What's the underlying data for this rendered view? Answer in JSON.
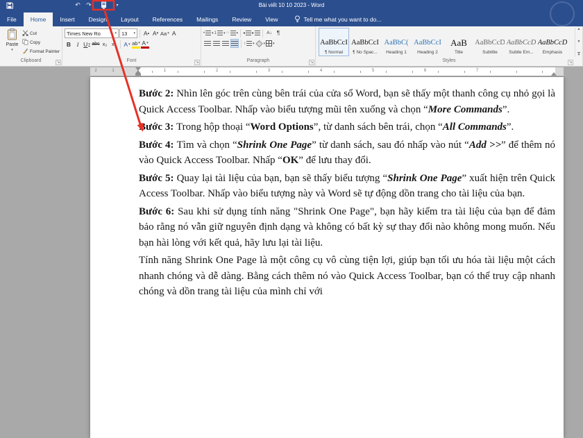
{
  "app": {
    "title": "Bài viết 10 10 2023 - Word"
  },
  "colors": {
    "titlebar": "#2b4e8e",
    "accent": "#2b579a",
    "ribbon_bg": "#f3f3f3",
    "document_bg": "#a9a9a9",
    "annotation_red": "#e53226",
    "highlight_yellow": "#ffe400",
    "font_color_red": "#c00000"
  },
  "icons": {
    "qat": [
      "save-icon",
      "undo-icon",
      "redo-icon",
      "shrink-one-page-icon",
      "customize-qat-chevron-icon"
    ],
    "undo_glyph": "↶",
    "redo_glyph": "↷",
    "dropdown_glyph": "▾",
    "launcher_glyph": "↘"
  },
  "ribbon": {
    "tabs": [
      {
        "label": "File",
        "active": false
      },
      {
        "label": "Home",
        "active": true
      },
      {
        "label": "Insert",
        "active": false
      },
      {
        "label": "Design",
        "active": false
      },
      {
        "label": "Layout",
        "active": false
      },
      {
        "label": "References",
        "active": false
      },
      {
        "label": "Mailings",
        "active": false
      },
      {
        "label": "Review",
        "active": false
      },
      {
        "label": "View",
        "active": false
      }
    ],
    "tell_me": "Tell me what you want to do...",
    "clipboard": {
      "label": "Clipboard",
      "paste": "Paste",
      "cut": "Cut",
      "copy": "Copy",
      "format_painter": "Format Painter"
    },
    "font": {
      "label": "Font",
      "family": "Times New Ro",
      "size": "13",
      "bold": "B",
      "italic": "I",
      "underline": "U",
      "strikethrough": "abc",
      "subscript": "x₂",
      "superscript": "x²",
      "grow": "A",
      "shrink": "A",
      "change_case": "Aa",
      "clear": "A",
      "text_effects": "A",
      "highlight": "ab",
      "font_color": "A"
    },
    "paragraph": {
      "label": "Paragraph",
      "pilcrow": "¶",
      "sort": "A↓"
    },
    "styles": {
      "label": "Styles",
      "items": [
        {
          "preview": "AaBbCcI",
          "name": "¶ Normal",
          "selected": true
        },
        {
          "preview": "AaBbCcI",
          "name": "¶ No Spac..."
        },
        {
          "preview": "AaBbC(",
          "name": "Heading 1",
          "color": "#2e74b5"
        },
        {
          "preview": "AaBbCcI",
          "name": "Heading 2",
          "color": "#2e74b5"
        },
        {
          "preview": "AaB",
          "name": "Title",
          "size": 13
        },
        {
          "preview": "AaBbCcD",
          "name": "Subtitle",
          "color": "#666666"
        },
        {
          "preview": "AaBbCcD",
          "name": "Subtle Em...",
          "color": "#666666",
          "italic": true
        },
        {
          "preview": "AaBbCcD",
          "name": "Emphasis",
          "italic": true
        }
      ]
    }
  },
  "ruler": {
    "margin_numbers": [
      "2",
      "1"
    ],
    "numbers": [
      "1",
      "2",
      "3",
      "4",
      "5",
      "6",
      "7"
    ]
  },
  "document": {
    "paragraphs": [
      {
        "segments": [
          {
            "t": "Bước 2: ",
            "b": true
          },
          {
            "t": "Nhìn lên góc trên cùng bên trái của cửa sổ Word, bạn sẽ thấy một thanh công cụ nhỏ gọi là Quick Access Toolbar. Nhấp vào biểu tượng mũi tên xuống và chọn “"
          },
          {
            "t": "More Commands",
            "b": true,
            "i": true
          },
          {
            "t": "”."
          }
        ]
      },
      {
        "segments": [
          {
            "t": "Bước 3: ",
            "b": true
          },
          {
            "t": "Trong hộp thoại “"
          },
          {
            "t": "Word Options",
            "b": true
          },
          {
            "t": "”, từ danh sách bên trái, chọn “"
          },
          {
            "t": "All Commands",
            "b": true,
            "i": true
          },
          {
            "t": "”."
          }
        ]
      },
      {
        "segments": [
          {
            "t": "Bước 4: ",
            "b": true
          },
          {
            "t": "Tìm và chọn “"
          },
          {
            "t": "Shrink One Page",
            "b": true,
            "i": true
          },
          {
            "t": "” từ danh sách, sau đó nhấp vào nút “"
          },
          {
            "t": "Add >>",
            "b": true,
            "i": true
          },
          {
            "t": "” để thêm nó vào Quick Access Toolbar. Nhấp “"
          },
          {
            "t": "OK",
            "b": true
          },
          {
            "t": "” để lưu thay đổi."
          }
        ]
      },
      {
        "segments": [
          {
            "t": "Bước 5: ",
            "b": true
          },
          {
            "t": "Quay lại tài liệu của bạn, bạn sẽ thấy biểu tượng “"
          },
          {
            "t": "Shrink One Page",
            "b": true,
            "i": true
          },
          {
            "t": "” xuất hiện trên Quick Access Toolbar. Nhấp vào biểu tượng này và Word sẽ tự động dồn trang cho tài liệu của bạn."
          }
        ]
      },
      {
        "segments": [
          {
            "t": "Bước 6: ",
            "b": true
          },
          {
            "t": "Sau khi sử dụng tính năng \"Shrink One Page\", bạn hãy kiểm tra tài liệu của bạn để đảm bảo rằng nó vẫn giữ nguyên định dạng và không có bất kỳ sự thay đổi nào không mong muốn. Nếu bạn hài lòng với kết quả, hãy lưu lại tài liệu."
          }
        ]
      },
      {
        "segments": [
          {
            "t": "Tính năng Shrink One Page là một công cụ vô cùng tiện lợi, giúp bạn tối ưu hóa tài liệu một cách nhanh chóng và dễ dàng. Bằng cách thêm nó vào Quick Access Toolbar, bạn có thể truy cập nhanh chóng và dồn trang tài liệu của mình chỉ với"
          }
        ]
      }
    ]
  }
}
